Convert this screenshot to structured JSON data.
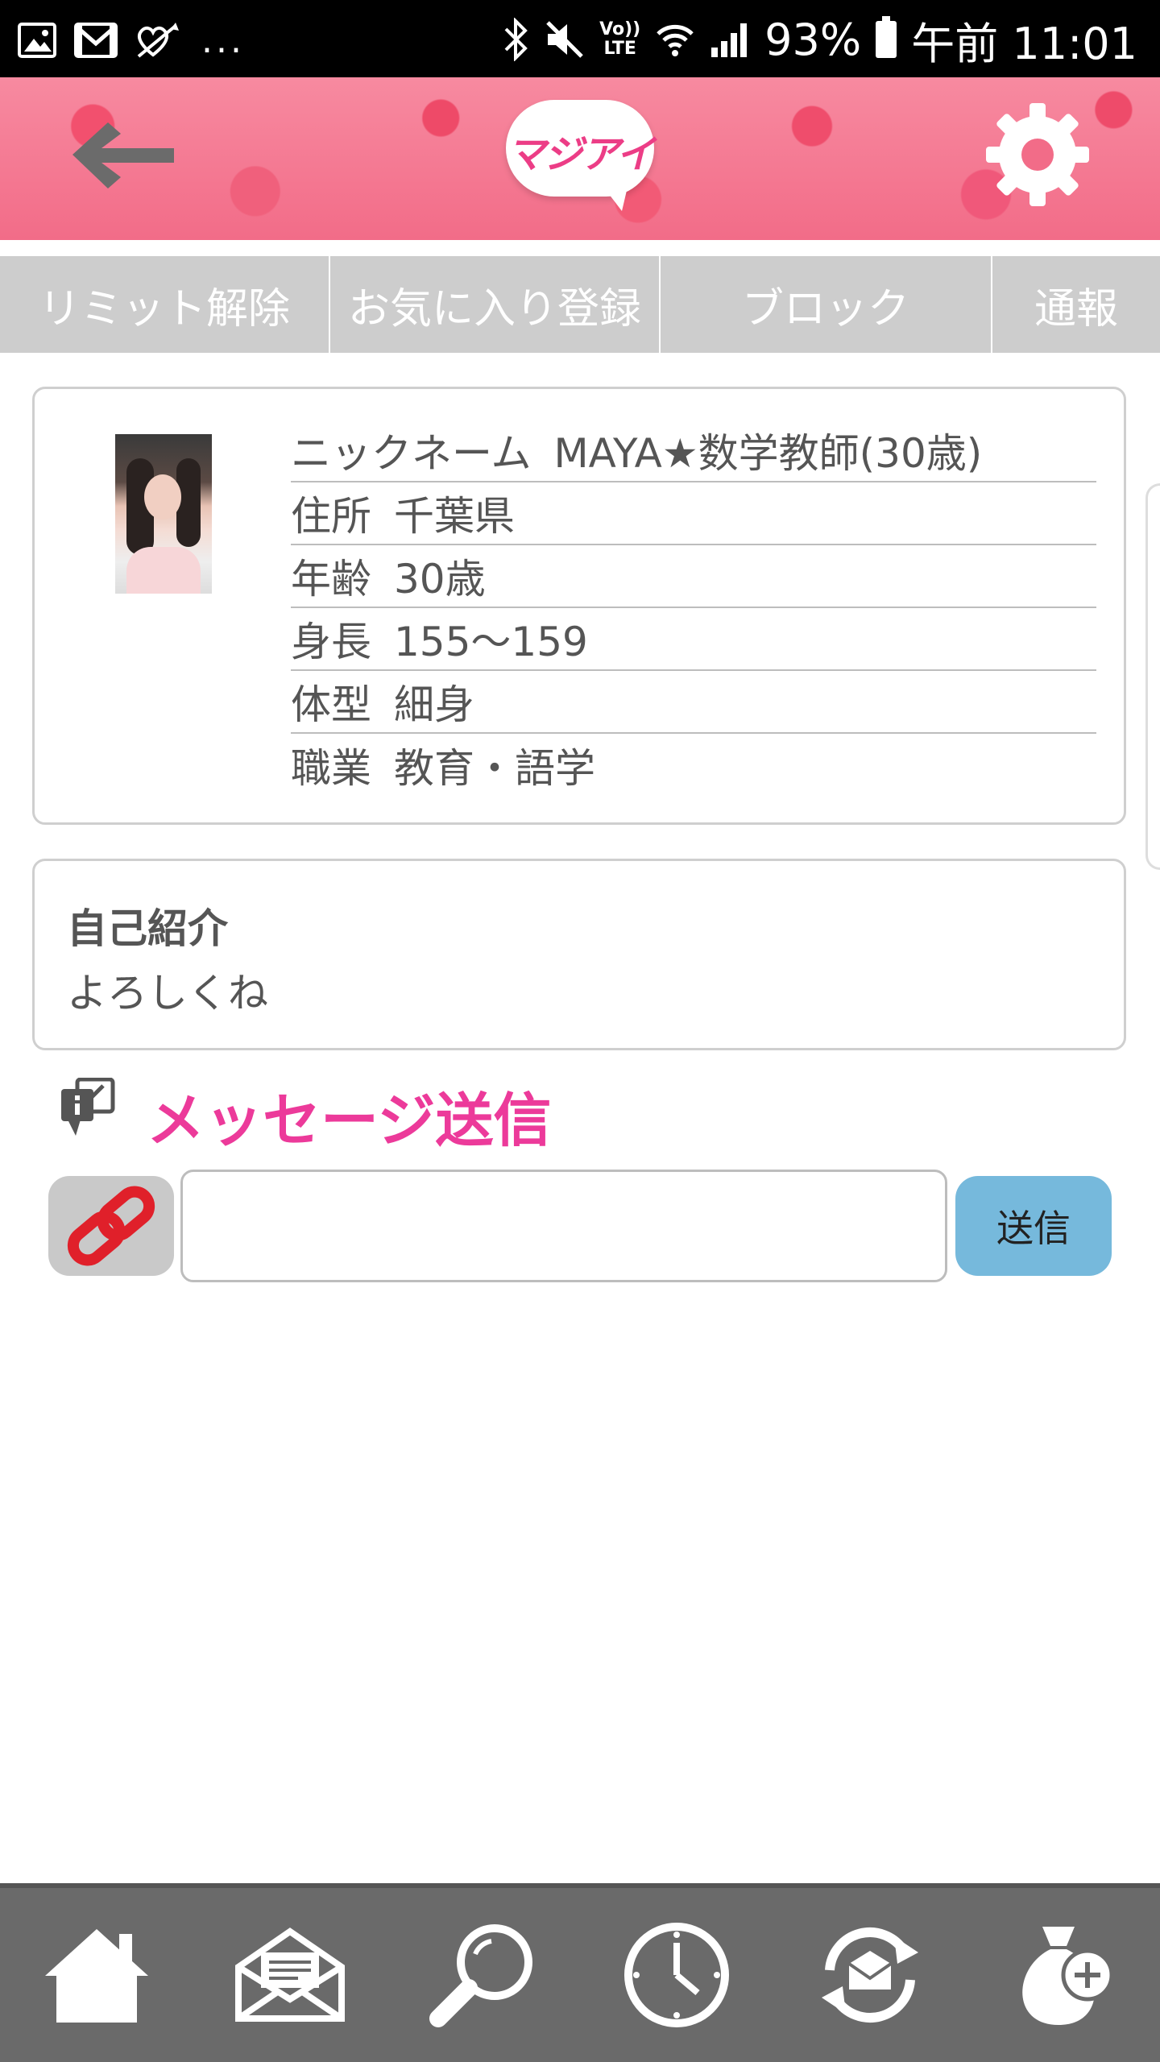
{
  "status_bar": {
    "left_icons": [
      "image-icon",
      "gmail-icon",
      "heart-arrow-icon"
    ],
    "more": "...",
    "right_icons": [
      "bluetooth-icon",
      "mute-icon",
      "volte-icon",
      "wifi-icon",
      "signal-icon",
      "battery-icon"
    ],
    "volte_label_top": "Vo))",
    "volte_label_bottom": "LTE",
    "battery": "93%",
    "time": "午前 11:01"
  },
  "header": {
    "logo_text": "マジアイ",
    "brand_color": "#ec3d86"
  },
  "tabs": [
    {
      "label": "リミット解除"
    },
    {
      "label": "お気に入り登録"
    },
    {
      "label": "ブロック"
    },
    {
      "label": "通報"
    }
  ],
  "profile": {
    "rows": [
      {
        "label": "ニックネーム",
        "value": "MAYA★数学教師(30歳)"
      },
      {
        "label": "住所",
        "value": "千葉県"
      },
      {
        "label": "年齢",
        "value": "30歳"
      },
      {
        "label": "身長",
        "value": "155～159"
      },
      {
        "label": "体型",
        "value": "細身"
      },
      {
        "label": "職業",
        "value": "教育・語学"
      }
    ]
  },
  "intro": {
    "heading": "自己紹介",
    "body": "よろしくね"
  },
  "message": {
    "title": "メッセージ送信",
    "title_color": "#ec3a9a",
    "input_value": "",
    "input_placeholder": "",
    "send_label": "送信",
    "send_color": "#76b9dc"
  },
  "bottom_nav": [
    {
      "icon": "home-icon"
    },
    {
      "icon": "mail-icon"
    },
    {
      "icon": "search-icon"
    },
    {
      "icon": "history-clock-icon"
    },
    {
      "icon": "mail-sync-icon"
    },
    {
      "icon": "points-bag-add-icon"
    }
  ]
}
